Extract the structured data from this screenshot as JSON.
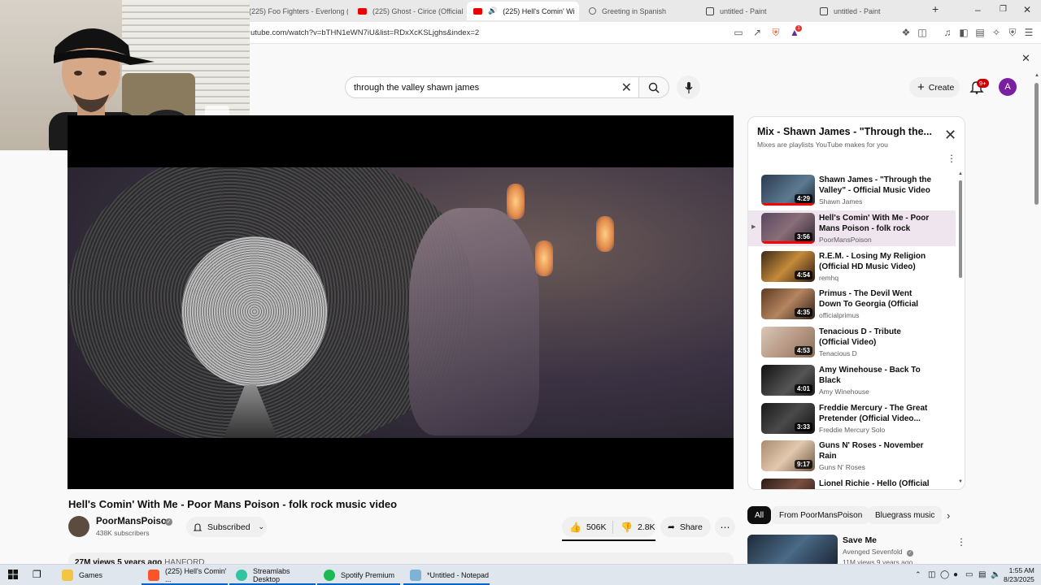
{
  "browser": {
    "tabs": [
      {
        "label": "(225) Foo Fighters - Everlong (",
        "icon": "youtube-icon",
        "active": false
      },
      {
        "label": "(225) Ghost - Cirice (Official M",
        "icon": "youtube-icon",
        "active": false
      },
      {
        "label": "(225) Hell's Comin' Wi",
        "icon": "youtube-icon",
        "active": true
      },
      {
        "label": "Greeting in Spanish",
        "icon": "globe-icon",
        "active": false
      },
      {
        "label": "untitled - Paint",
        "icon": "paint-icon",
        "active": false
      },
      {
        "label": "untitled - Paint",
        "icon": "paint-icon",
        "active": false
      }
    ],
    "new_tab": "+",
    "url": "utube.com/watch?v=bTHN1eWN7iU&list=RDxXcKSLjghs&index=2",
    "shields_badge": "1"
  },
  "youtube": {
    "search_query": "through the valley shawn james",
    "create_label": "Create",
    "notifications_badge": "9+",
    "avatar_letter": "A",
    "video": {
      "title": "Hell's Comin' With Me - Poor Mans Poison - folk rock music video",
      "channel": "PoorMansPoison",
      "subscribers": "438K subscribers",
      "subscribed_label": "Subscribed",
      "likes": "506K",
      "dislikes": "2.8K",
      "share_label": "Share",
      "views_text": "27M views  5 years ago",
      "hashtag": "HANFORD"
    },
    "playlist": {
      "title": "Mix - Shawn James - \"Through the...",
      "subtitle": "Mixes are playlists YouTube makes for you",
      "items": [
        {
          "title": "Shawn James - \"Through the Valley\" - Official Music Video",
          "channel": "Shawn James",
          "duration": "4:29",
          "current": false,
          "watched": true
        },
        {
          "title": "Hell's Comin' With Me - Poor Mans Poison - folk rock musi...",
          "channel": "PoorMansPoison",
          "duration": "3:56",
          "current": true,
          "watched": true
        },
        {
          "title": "R.E.M. - Losing My Religion (Official HD Music Video)",
          "channel": "remhq",
          "duration": "4:54",
          "current": false,
          "watched": false
        },
        {
          "title": "Primus - The Devil Went Down To Georgia (Official Music...",
          "channel": "officialprimus",
          "duration": "4:35",
          "current": false,
          "watched": false
        },
        {
          "title": "Tenacious D - Tribute (Official Video)",
          "channel": "Tenacious D",
          "duration": "4:53",
          "current": false,
          "watched": false
        },
        {
          "title": "Amy Winehouse - Back To Black",
          "channel": "Amy Winehouse",
          "duration": "4:01",
          "current": false,
          "watched": false
        },
        {
          "title": "Freddie Mercury - The Great Pretender (Official Video...",
          "channel": "Freddie Mercury Solo",
          "duration": "3:33",
          "current": false,
          "watched": false
        },
        {
          "title": "Guns N' Roses - November Rain",
          "channel": "Guns N' Roses",
          "duration": "9:17",
          "current": false,
          "watched": false
        },
        {
          "title": "Lionel Richie - Hello (Official",
          "channel": "",
          "duration": "",
          "current": false,
          "watched": false
        }
      ]
    },
    "chips": [
      "All",
      "From PoorMansPoison",
      "Bluegrass music"
    ],
    "recommendation": {
      "title": "Save Me",
      "channel": "Avenged Sevenfold",
      "meta": "11M views  9 years ago"
    }
  },
  "taskbar": {
    "items": [
      {
        "label": "Games",
        "open": false
      },
      {
        "label": "(225) Hell's Comin' ...",
        "open": true
      },
      {
        "label": "Streamlabs Desktop",
        "open": true
      },
      {
        "label": "Spotify Premium",
        "open": true
      },
      {
        "label": "*Untitled - Notepad",
        "open": true
      }
    ],
    "time": "1:55 AM",
    "date": "8/23/2025"
  }
}
